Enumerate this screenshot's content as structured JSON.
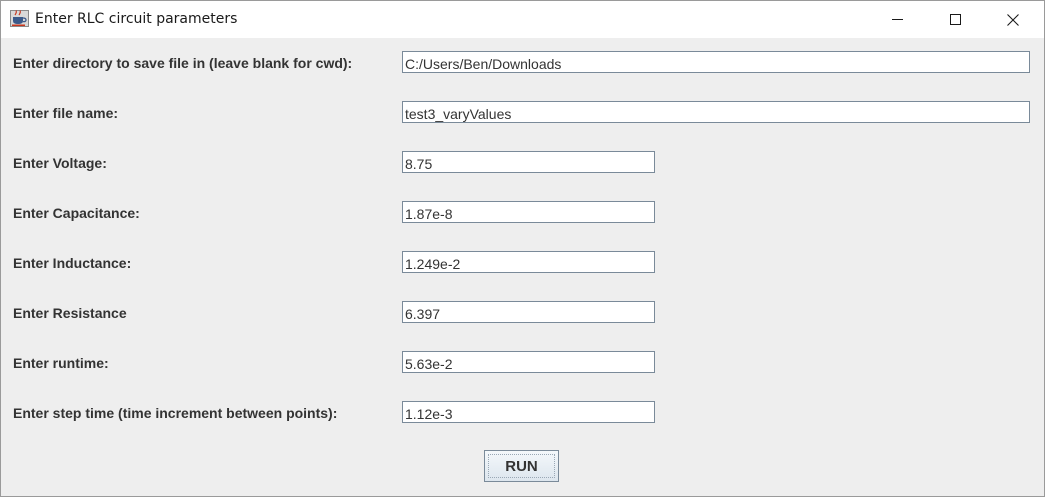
{
  "window": {
    "title": "Enter RLC circuit parameters",
    "icon": "java-coffee-cup-icon"
  },
  "title_controls": {
    "minimize_icon": "minimize-icon",
    "maximize_icon": "maximize-icon",
    "close_icon": "close-icon"
  },
  "form": {
    "directory": {
      "label": "Enter directory to save file in (leave blank for cwd):",
      "value": "C:/Users/Ben/Downloads"
    },
    "filename": {
      "label": "Enter file name:",
      "value": "test3_varyValues"
    },
    "voltage": {
      "label": "Enter Voltage:",
      "value": "8.75"
    },
    "capacitance": {
      "label": "Enter Capacitance:",
      "value": "1.87e-8"
    },
    "inductance": {
      "label": "Enter Inductance:",
      "value": "1.249e-2"
    },
    "resistance": {
      "label": "Enter Resistance",
      "value": "6.397"
    },
    "runtime": {
      "label": "Enter runtime:",
      "value": "5.63e-2"
    },
    "steptime": {
      "label": "Enter step time (time increment between points):",
      "value": "1.12e-3"
    }
  },
  "run_button": {
    "label": "RUN"
  },
  "colors": {
    "background": "#eeeeee",
    "titlebar": "#ffffff",
    "field_border": "#7a8a99",
    "label_text": "#333333"
  }
}
